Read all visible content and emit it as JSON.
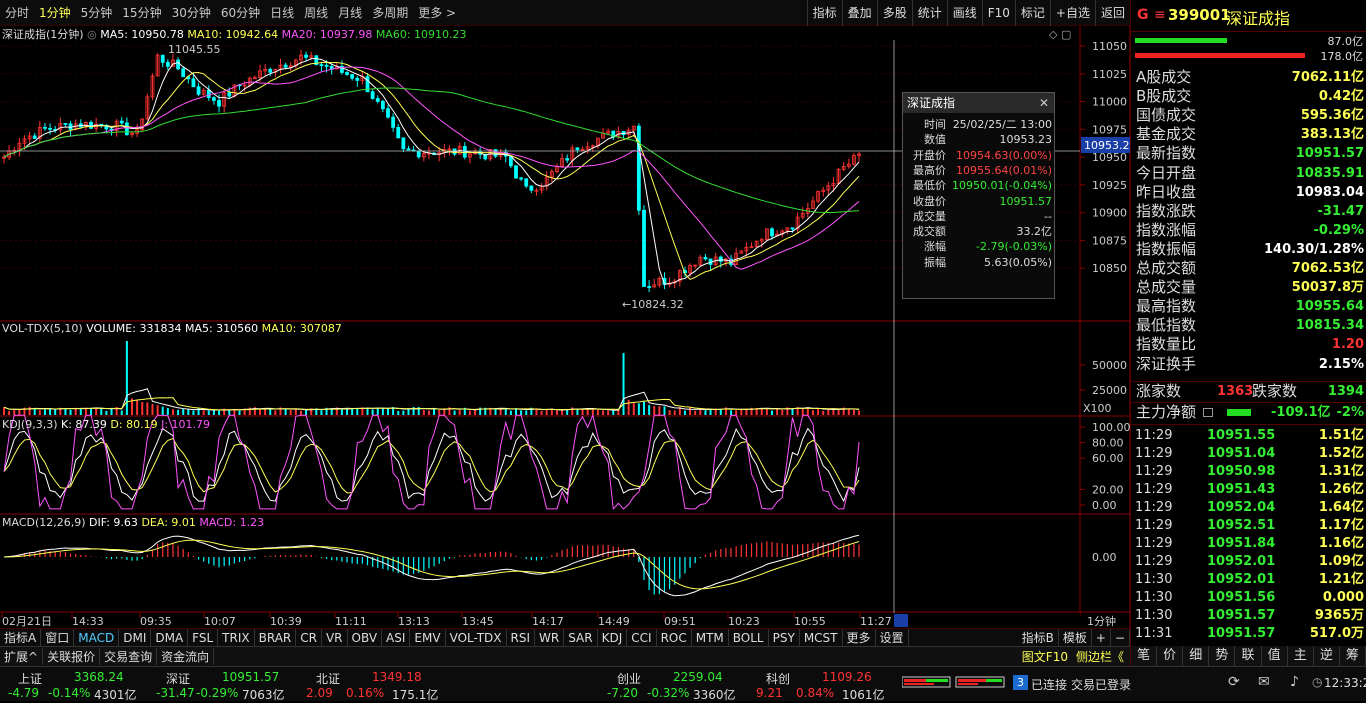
{
  "periods": [
    "分时",
    "1分钟",
    "5分钟",
    "15分钟",
    "30分钟",
    "60分钟",
    "日线",
    "周线",
    "月线",
    "多周期",
    "更多 >"
  ],
  "active_period": 1,
  "toolbar": [
    "指标",
    "叠加",
    "多股",
    "统计",
    "画线",
    "F10",
    "标记",
    "+自选",
    "返回"
  ],
  "main_indicator": {
    "name": "深证成指(1分钟)",
    "ma5": "MA5: 10950.78",
    "ma10": "MA10: 10942.64",
    "ma20": "MA20: 10937.98",
    "ma60": "MA60: 10910.23"
  },
  "price_axis": [
    "11050",
    "11025",
    "11000",
    "10975",
    "10950",
    "10925",
    "10900",
    "10875",
    "10850"
  ],
  "crosshair_price": "10953.2",
  "high_label": "11045.55",
  "low_label": "10824.32",
  "vol_indicator": {
    "name": "VOL-TDX(5,10)",
    "volume": "VOLUME: 331834",
    "ma5": "MA5: 310560",
    "ma10": "MA10: 307087"
  },
  "vol_axis": [
    "50000",
    "25000"
  ],
  "vol_unit": "X100",
  "kdj_indicator": {
    "name": "KDJ(9,3,3)",
    "k": "K: 87.39",
    "d": "D: 80.19",
    "j": "J: 101.79"
  },
  "kdj_axis": [
    "100.00",
    "80.00",
    "60.00",
    "20.00",
    "0.00"
  ],
  "macd_indicator": {
    "name": "MACD(12,26,9)",
    "dif": "DIF: 9.63",
    "dea": "DEA: 9.01",
    "macd": "MACD: 1.23"
  },
  "macd_axis": [
    "0.00"
  ],
  "time_axis": [
    "02月21日",
    "14:33",
    "09:35",
    "10:07",
    "10:39",
    "11:11",
    "13:13",
    "13:45",
    "14:17",
    "14:49",
    "09:51",
    "10:23",
    "10:55",
    "11:27"
  ],
  "time_axis_corner": "1分钟",
  "popup": {
    "title": "深证成指",
    "rows": [
      {
        "k": "时间",
        "v": "25/02/25/二 13:00",
        "c": "#dddddd"
      },
      {
        "k": "数值",
        "v": "10953.23",
        "c": "#dddddd"
      },
      {
        "k": "开盘价",
        "v": "10954.63(0.00%)",
        "c": "#ff4444"
      },
      {
        "k": "最高价",
        "v": "10955.64(0.01%)",
        "c": "#ff4444"
      },
      {
        "k": "最低价",
        "v": "10950.01(-0.04%)",
        "c": "#33ee33"
      },
      {
        "k": "收盘价",
        "v": "10951.57",
        "c": "#33ee33"
      },
      {
        "k": "成交量",
        "v": "--",
        "c": "#dddddd"
      },
      {
        "k": "成交额",
        "v": "33.2亿",
        "c": "#dddddd"
      },
      {
        "k": "涨幅",
        "v": "-2.79(-0.03%)",
        "c": "#33ee33"
      },
      {
        "k": "振幅",
        "v": "5.63(0.05%)",
        "c": "#dddddd"
      }
    ]
  },
  "indicator_tabs": [
    "指标A",
    "窗口",
    "MACD",
    "DMI",
    "DMA",
    "FSL",
    "TRIX",
    "BRAR",
    "CR",
    "VR",
    "OBV",
    "ASI",
    "EMV",
    "VOL-TDX",
    "RSI",
    "WR",
    "SAR",
    "KDJ",
    "CCI",
    "ROC",
    "MTM",
    "BOLL",
    "PSY",
    "MCST",
    "更多",
    "设置"
  ],
  "active_indicator_tab": 2,
  "indicator_tabs_right": [
    "指标B",
    "模板",
    "+",
    "−"
  ],
  "sub_tabs": [
    "扩展^",
    "关联报价",
    "交易查询",
    "资金流向"
  ],
  "right_header": {
    "flag": "G",
    "menu": "≡",
    "code": "399001",
    "name": "深证成指"
  },
  "bars": [
    {
      "v": "87.0亿",
      "w": 92,
      "c": "#22dd22"
    },
    {
      "v": "178.0亿",
      "w": 170,
      "c": "#ee2222"
    }
  ],
  "stats": [
    {
      "l": "A股成交",
      "v": "7062.11亿",
      "c": "#ffff55"
    },
    {
      "l": "B股成交",
      "v": "0.42亿",
      "c": "#ffff55"
    },
    {
      "l": "国债成交",
      "v": "595.36亿",
      "c": "#ffff55"
    },
    {
      "l": "基金成交",
      "v": "383.13亿",
      "c": "#ffff55"
    },
    {
      "l": "最新指数",
      "v": "10951.57",
      "c": "#33ee33"
    },
    {
      "l": "今日开盘",
      "v": "10835.91",
      "c": "#33ee33"
    },
    {
      "l": "昨日收盘",
      "v": "10983.04",
      "c": "#ffffff"
    },
    {
      "l": "指数涨跌",
      "v": "-31.47",
      "c": "#33ee33"
    },
    {
      "l": "指数涨幅",
      "v": "-0.29%",
      "c": "#33ee33"
    },
    {
      "l": "指数振幅",
      "v": "140.30/1.28%",
      "c": "#ffffff"
    },
    {
      "l": "总成交额",
      "v": "7062.53亿",
      "c": "#ffff55"
    },
    {
      "l": "总成交量",
      "v": "50037.8万",
      "c": "#ffff55"
    },
    {
      "l": "最高指数",
      "v": "10955.64",
      "c": "#33ee33"
    },
    {
      "l": "最低指数",
      "v": "10815.34",
      "c": "#33ee33"
    },
    {
      "l": "指数量比",
      "v": "1.20",
      "c": "#ff3333"
    },
    {
      "l": "深证换手",
      "v": "2.15%",
      "c": "#ffffff"
    }
  ],
  "updown": {
    "up_label": "涨家数",
    "up": "1363",
    "down_label": "跌家数",
    "down": "1394"
  },
  "net": {
    "label": "主力净额",
    "value": "-109.1亿",
    "pct": "-2%"
  },
  "ticks": [
    {
      "t": "11:29",
      "p": "10951.55",
      "v": "1.51亿"
    },
    {
      "t": "11:29",
      "p": "10951.04",
      "v": "1.52亿"
    },
    {
      "t": "11:29",
      "p": "10950.98",
      "v": "1.31亿"
    },
    {
      "t": "11:29",
      "p": "10951.43",
      "v": "1.26亿"
    },
    {
      "t": "11:29",
      "p": "10952.04",
      "v": "1.64亿"
    },
    {
      "t": "11:29",
      "p": "10952.51",
      "v": "1.17亿"
    },
    {
      "t": "11:29",
      "p": "10951.84",
      "v": "1.16亿"
    },
    {
      "t": "11:29",
      "p": "10952.01",
      "v": "1.09亿"
    },
    {
      "t": "11:30",
      "p": "10952.01",
      "v": "1.21亿"
    },
    {
      "t": "11:30",
      "p": "10951.56",
      "v": "0.000"
    },
    {
      "t": "11:30",
      "p": "10951.57",
      "v": "9365万"
    },
    {
      "t": "11:31",
      "p": "10951.57",
      "v": "517.0万"
    }
  ],
  "right_tabs_top": [
    "图文F10",
    "侧边栏《"
  ],
  "right_tabs": [
    "笔",
    "价",
    "细",
    "势",
    "联",
    "值",
    "主",
    "逆",
    "筹"
  ],
  "indices": [
    {
      "name": "上证",
      "price": "3368.24",
      "chg": "-4.79",
      "pct": "-0.14%",
      "amt": "4301亿",
      "pc": "#33ee33"
    },
    {
      "name": "深证",
      "price": "10951.57",
      "chg": "-31.47",
      "pct": "-0.29%",
      "amt": "7063亿",
      "pc": "#33ee33"
    },
    {
      "name": "北证",
      "price": "1349.18",
      "chg": "2.09",
      "pct": "0.16%",
      "amt": "175.1亿",
      "pc": "#ff3333"
    },
    {
      "name": "创业",
      "price": "2259.04",
      "chg": "-7.20",
      "pct": "-0.32%",
      "amt": "3360亿",
      "pc": "#33ee33"
    },
    {
      "name": "科创",
      "price": "1109.26",
      "chg": "9.21",
      "pct": "0.84%",
      "amt": "1061亿",
      "pc": "#ff3333"
    }
  ],
  "status": {
    "conn_count": "3",
    "conn": "已连接",
    "trade": "交易已登录",
    "time": "12:33:23"
  }
}
